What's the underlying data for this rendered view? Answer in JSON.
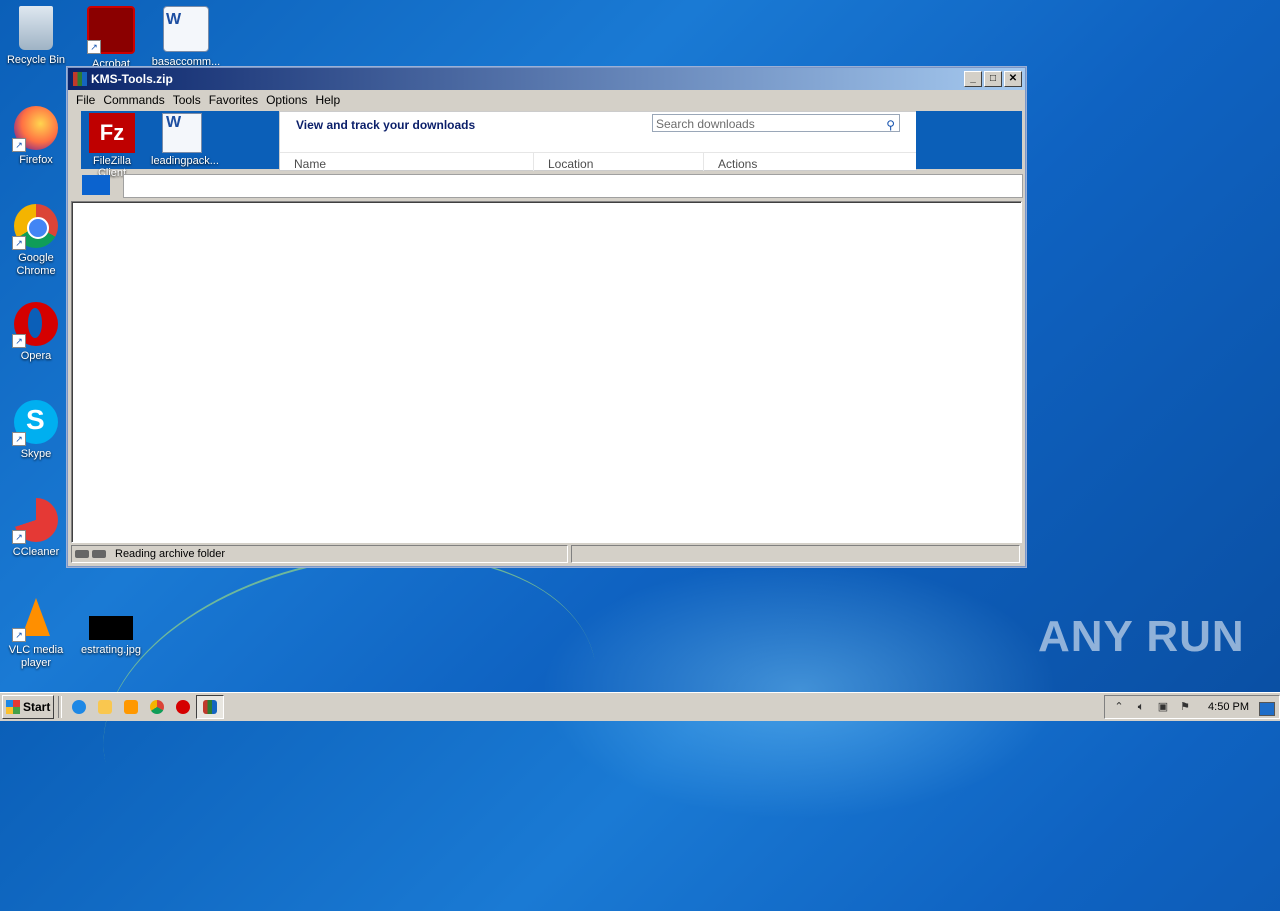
{
  "desktop": {
    "icons": [
      {
        "label": "Recycle Bin"
      },
      {
        "label": "Acrobat"
      },
      {
        "label": "basaccomm..."
      },
      {
        "label": "Firefox"
      },
      {
        "label": "Google Chrome"
      },
      {
        "label": "Opera"
      },
      {
        "label": "Skype"
      },
      {
        "label": "CCleaner"
      },
      {
        "label": "VLC media player"
      },
      {
        "label": "estrating.jpg"
      }
    ],
    "watermark": "ANY RUN"
  },
  "window": {
    "title": "KMS-Tools.zip",
    "controls": {
      "minimize": "_",
      "maximize": "□",
      "close": "✕"
    },
    "menu": [
      "File",
      "Commands",
      "Tools",
      "Favorites",
      "Options",
      "Help"
    ],
    "toolbar_icons": [
      {
        "label": "FileZilla Client"
      },
      {
        "label": "leadingpack..."
      }
    ],
    "downloads_panel": {
      "title": "View and track your downloads",
      "search_placeholder": "Search downloads",
      "columns": [
        "Name",
        "Location",
        "Actions"
      ]
    },
    "status": {
      "text": "Reading archive folder"
    }
  },
  "taskbar": {
    "start_label": "Start",
    "clock": "4:50 PM"
  },
  "colors": {
    "desktop_bg": "#1a7ad4",
    "title_start": "#0a246a",
    "title_end": "#a6caf0",
    "window_face": "#d4d0c8"
  }
}
